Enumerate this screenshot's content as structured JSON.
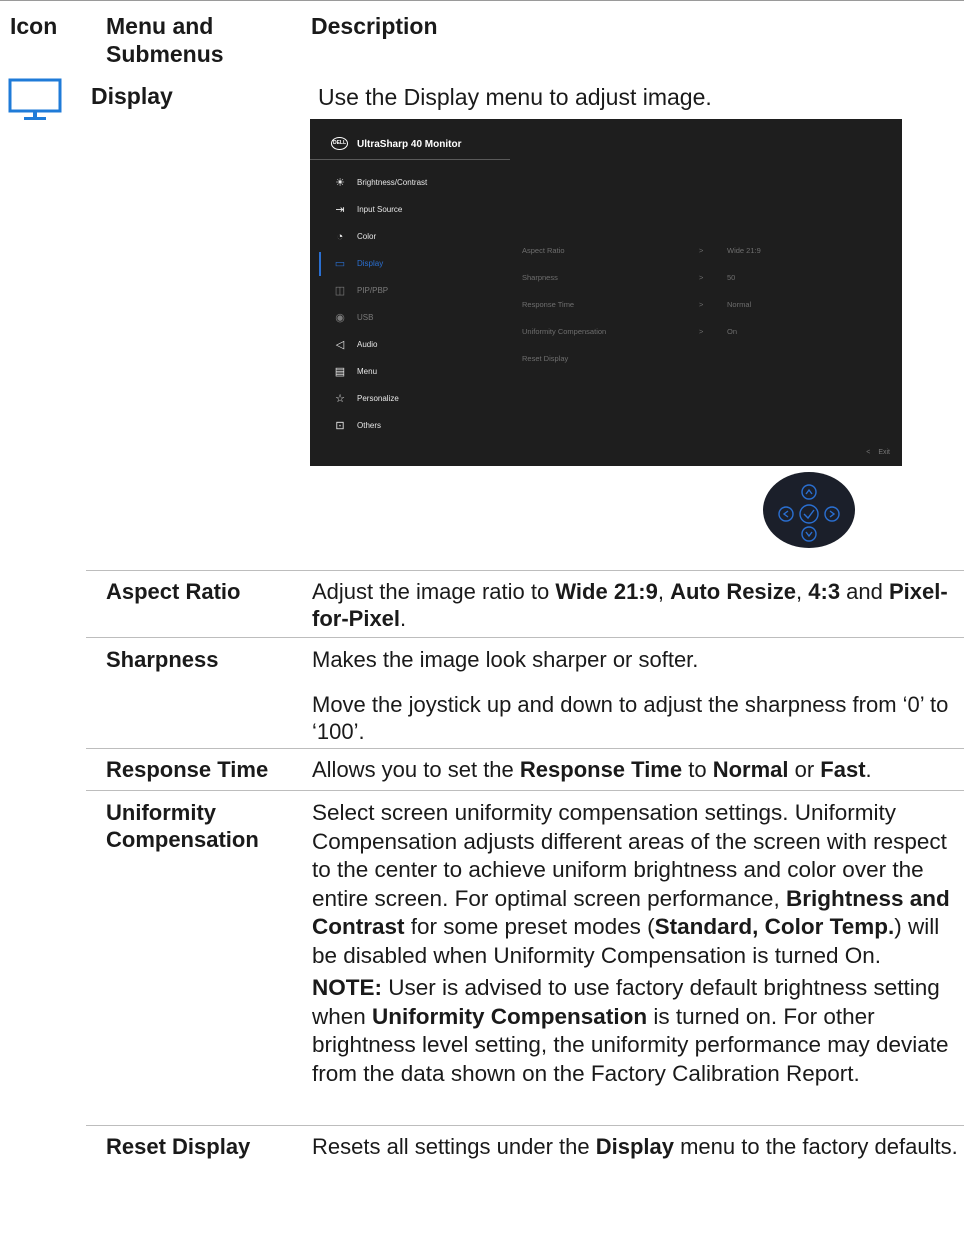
{
  "header": {
    "icon_col": "Icon",
    "menu_col": "Menu and Submenus",
    "desc_col": "Description"
  },
  "display_row": {
    "icon": "monitor-icon",
    "menu": "Display",
    "description": "Use the Display menu to adjust image."
  },
  "osd": {
    "title": "UltraSharp 40 Monitor",
    "logo": "DELL",
    "menu_items": [
      {
        "label": "Brightness/Contrast",
        "icon": "sun-icon",
        "state": "normal"
      },
      {
        "label": "Input Source",
        "icon": "input-icon",
        "state": "normal"
      },
      {
        "label": "Color",
        "icon": "palette-icon",
        "state": "normal"
      },
      {
        "label": "Display",
        "icon": "monitor-icon",
        "state": "active"
      },
      {
        "label": "PIP/PBP",
        "icon": "pip-icon",
        "state": "dim"
      },
      {
        "label": "USB",
        "icon": "mouse-icon",
        "state": "dim"
      },
      {
        "label": "Audio",
        "icon": "speaker-icon",
        "state": "normal"
      },
      {
        "label": "Menu",
        "icon": "menu-icon",
        "state": "normal"
      },
      {
        "label": "Personalize",
        "icon": "star-icon",
        "state": "normal"
      },
      {
        "label": "Others",
        "icon": "others-icon",
        "state": "normal"
      }
    ],
    "submenu": [
      {
        "name": "Aspect Ratio",
        "chevron": ">",
        "value": "Wide 21:9"
      },
      {
        "name": "Sharpness",
        "chevron": ">",
        "value": "50"
      },
      {
        "name": "Response Time",
        "chevron": ">",
        "value": "Normal"
      },
      {
        "name": "Uniformity Compensation",
        "chevron": ">",
        "value": "On"
      },
      {
        "name": "Reset Display",
        "chevron": "",
        "value": ""
      }
    ],
    "exit_label": "Exit",
    "exit_chevron": "<"
  },
  "joystick": {
    "icon": "joystick-icon",
    "accent": "#2a6fd1",
    "bg": "#1b1f2a"
  },
  "rows": [
    {
      "label": "Aspect Ratio",
      "segments": [
        {
          "t": "Adjust the image ratio to ",
          "b": false
        },
        {
          "t": "Wide 21:9",
          "b": true
        },
        {
          "t": ", ",
          "b": false
        },
        {
          "t": "Auto Resize",
          "b": true
        },
        {
          "t": ", ",
          "b": false
        },
        {
          "t": "4:3",
          "b": true
        },
        {
          "t": " and ",
          "b": false
        },
        {
          "t": "Pixel-for-Pixel",
          "b": true
        },
        {
          "t": ".",
          "b": false
        }
      ]
    },
    {
      "label": "Sharpness",
      "p1": "Makes the image look sharper or softer.",
      "p2": "Move the joystick up and down to adjust the sharpness from ‘0’ to ‘100’."
    },
    {
      "label": "Response Time",
      "segments": [
        {
          "t": "Allows you to set the ",
          "b": false
        },
        {
          "t": "Response Time",
          "b": true
        },
        {
          "t": " to ",
          "b": false
        },
        {
          "t": "Normal",
          "b": true
        },
        {
          "t": " or ",
          "b": false
        },
        {
          "t": "Fast",
          "b": true
        },
        {
          "t": ".",
          "b": false
        }
      ]
    },
    {
      "label1": "Uniformity",
      "label2": "Compensation",
      "para1": [
        {
          "t": "Select screen uniformity compensation settings. Uniformity Compensation adjusts different areas of the screen with respect to the center to achieve uniform brightness and color over the entire screen. For optimal screen performance, ",
          "b": false
        },
        {
          "t": "Brightness and Contrast",
          "b": true
        },
        {
          "t": " for some preset modes (",
          "b": false
        },
        {
          "t": "Standard, Color Temp.",
          "b": true
        },
        {
          "t": ") will be disabled when Uniformity Compensation is turned On.",
          "b": false
        }
      ],
      "para2": [
        {
          "t": "NOTE:",
          "b": true
        },
        {
          "t": " User is advised to use factory default brightness setting when ",
          "b": false
        },
        {
          "t": "Uniformity Compensation",
          "b": true
        },
        {
          "t": " is turned on. For other brightness level setting, the uniformity performance may deviate from the data shown on the Factory Calibration Report.",
          "b": false
        }
      ]
    },
    {
      "label": "Reset Display",
      "segments": [
        {
          "t": "Resets all settings under the ",
          "b": false
        },
        {
          "t": "Display",
          "b": true
        },
        {
          "t": " menu to the factory defaults.",
          "b": false
        }
      ]
    }
  ]
}
